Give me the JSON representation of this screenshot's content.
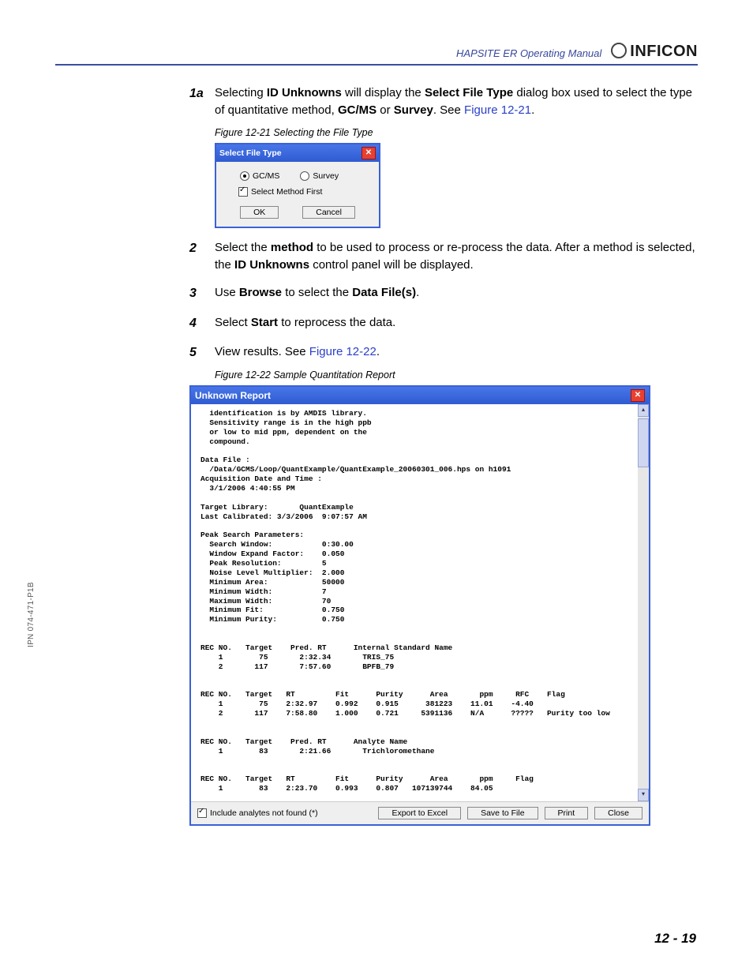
{
  "header": {
    "manual_title": "HAPSITE ER Operating Manual",
    "brand": "INFICON"
  },
  "side_label": "IPN 074-471-P1B",
  "page_number": "12 - 19",
  "steps": {
    "s1a": {
      "num": "1a",
      "pre": "Selecting ",
      "b1": "ID Unknowns",
      "mid1": " will display the ",
      "b2": "Select File Type",
      "mid2": " dialog box used to select the type of quantitative method, ",
      "b3": "GC/MS",
      "mid3": " or ",
      "b4": "Survey",
      "mid4": ". See ",
      "link": "Figure 12-21",
      "end": "."
    },
    "s2": {
      "num": "2",
      "pre": "Select the ",
      "b1": "method",
      "mid1": " to be used to process or re-process the data. After a method is selected, the ",
      "b2": "ID Unknowns",
      "end": " control panel will be displayed."
    },
    "s3": {
      "num": "3",
      "pre": "Use ",
      "b1": "Browse",
      "mid1": " to select the ",
      "b2": "Data File(s)",
      "end": "."
    },
    "s4": {
      "num": "4",
      "pre": "Select ",
      "b1": "Start",
      "end": " to reprocess the data."
    },
    "s5": {
      "num": "5",
      "pre": "View results. See ",
      "link": "Figure 12-22",
      "end": "."
    }
  },
  "figcaptions": {
    "f1": "Figure 12-21  Selecting the File Type",
    "f2": "Figure 12-22  Sample Quantitation Report"
  },
  "dialog1": {
    "title": "Select File Type",
    "opt_gcms": "GC/MS",
    "opt_survey": "Survey",
    "chk_label": "Select Method First",
    "ok": "OK",
    "cancel": "Cancel"
  },
  "dialog2": {
    "title": "Unknown Report",
    "footer_chk": "Include analytes not found (*)",
    "btn_excel": "Export to Excel",
    "btn_save": "Save to File",
    "btn_print": "Print",
    "btn_close": "Close",
    "body": "  identification is by AMDIS library.\n  Sensitivity range is in the high ppb\n  or low to mid ppm, dependent on the\n  compound.\n\nData File :\n  /Data/GCMS/Loop/QuantExample/QuantExample_20060301_006.hps on h1091\nAcquisition Date and Time :\n  3/1/2006 4:40:55 PM\n\nTarget Library:       QuantExample\nLast Calibrated: 3/3/2006  9:07:57 AM\n\nPeak Search Parameters:\n  Search Window:           0:30.00\n  Window Expand Factor:    0.050\n  Peak Resolution:         5\n  Noise Level Multiplier:  2.000\n  Minimum Area:            50000\n  Minimum Width:           7\n  Maximum Width:           70\n  Minimum Fit:             0.750\n  Minimum Purity:          0.750\n\n\nREC NO.   Target    Pred. RT      Internal Standard Name\n    1        75       2:32.34       TRIS_75\n    2       117       7:57.60       BPFB_79\n\n\nREC NO.   Target   RT         Fit      Purity      Area       ppm     RFC    Flag\n    1        75    2:32.97    0.992    0.915      381223    11.01    -4.40\n    2       117    7:58.80    1.000    0.721     5391136    N/A      ?????   Purity too low\n\n\nREC NO.   Target    Pred. RT      Analyte Name\n    1        83       2:21.66       Trichloromethane\n\n\nREC NO.   Target   RT         Fit      Purity      Area       ppm     Flag\n    1        83    2:23.70    0.993    0.807   107139744    84.05\n"
  }
}
